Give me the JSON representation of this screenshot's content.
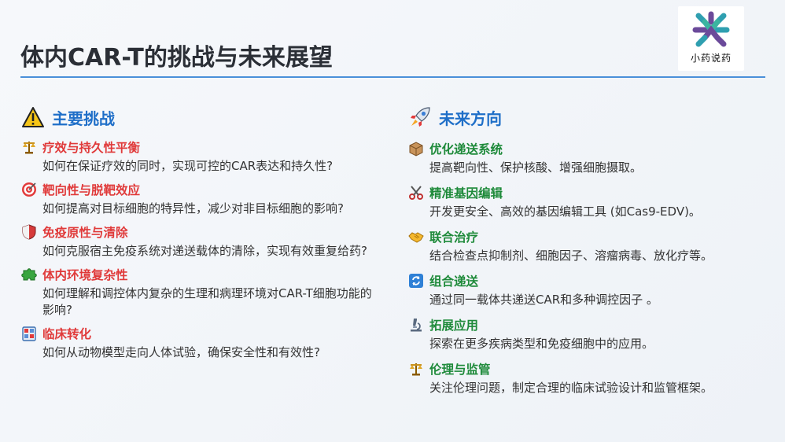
{
  "title": "体内CAR-T的挑战与未来展望",
  "logo": {
    "text": "小药说药"
  },
  "challenges": {
    "heading": "主要挑战",
    "icon": "warning-icon",
    "items": [
      {
        "icon": "balance-scale-icon",
        "title": "疗效与持久性平衡",
        "desc": "如何在保证疗效的同时，实现可控的CAR表达和持久性?"
      },
      {
        "icon": "target-icon",
        "title": "靶向性与脱靶效应",
        "desc": "如何提高对目标细胞的特异性，减少对非目标细胞的影响?"
      },
      {
        "icon": "shield-icon",
        "title": "免疫原性与清除",
        "desc": "如何克服宿主免疫系统对递送载体的清除，实现有效重复给药?"
      },
      {
        "icon": "puzzle-icon",
        "title": "体内环境复杂性",
        "desc": "如何理解和调控体内复杂的生理和病理环境对CAR-T细胞功能的影响?"
      },
      {
        "icon": "clinic-icon",
        "title": "临床转化",
        "desc": "如何从动物模型走向人体试验，确保安全性和有效性?"
      }
    ]
  },
  "future": {
    "heading": "未来方向",
    "icon": "rocket-icon",
    "items": [
      {
        "icon": "package-icon",
        "title": "优化递送系统",
        "desc": "提高靶向性、保护核酸、增强细胞摄取。"
      },
      {
        "icon": "scissors-icon",
        "title": "精准基因编辑",
        "desc": "开发更安全、高效的基因编辑工具 (如Cas9-EDV)。"
      },
      {
        "icon": "handshake-icon",
        "title": "联合治疗",
        "desc": "结合检查点抑制剂、细胞因子、溶瘤病毒、放化疗等。"
      },
      {
        "icon": "cycle-arrows-icon",
        "title": "组合递送",
        "desc": "通过同一载体共递送CAR和多种调控因子 。"
      },
      {
        "icon": "microscope-icon",
        "title": "拓展应用",
        "desc": "探索在更多疾病类型和免疫细胞中的应用。"
      },
      {
        "icon": "balance-scale-icon",
        "title": "伦理与监管",
        "desc": "关注伦理问题，制定合理的临床试验设计和监管框架。"
      }
    ]
  },
  "colors": {
    "accent": "#1f6fc8",
    "challenge_title": "#e03a3a",
    "future_title": "#1e8a3a",
    "rule": "#4a90d9"
  }
}
